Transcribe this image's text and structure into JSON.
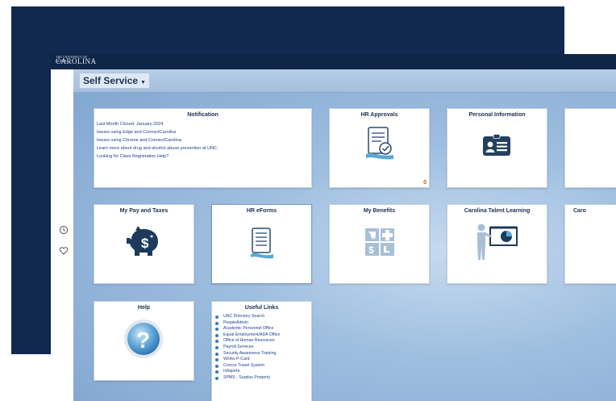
{
  "header": {
    "logo_small": "THE UNIVERSITY OF NORTH",
    "logo_text": "CAROLINA"
  },
  "page": {
    "title": "Self Service"
  },
  "sidebar": {
    "icons": [
      "clock-icon",
      "heart-icon"
    ]
  },
  "tiles": {
    "notification": {
      "title": "Notification",
      "items": [
        "Last Month Closed: January 2024",
        "Issues using Edge and ConnectCarolina",
        "Issues using Chrome and ConnectCarolina",
        "Learn more about drug and alcohol abuse prevention at UNC.",
        "Looking for Class Registration Help?"
      ]
    },
    "hr_approvals": {
      "title": "HR Approvals",
      "count": "0"
    },
    "personal_information": {
      "title": "Personal Information"
    },
    "my_pay": {
      "title": "My Pay and Taxes"
    },
    "hr_eforms": {
      "title": "HR eForms"
    },
    "my_benefits": {
      "title": "My Benefits"
    },
    "talent_learning": {
      "title": "Carolina Talent Learning"
    },
    "partial_car": {
      "title": "Caro"
    },
    "help": {
      "title": "Help"
    },
    "useful_links": {
      "title": "Useful Links",
      "items": [
        "UNC Directory Search",
        "PeopleAdmin",
        "Academic Personnel Office",
        "Equal Employment/ADA Office",
        "Office of Human Resources",
        "Payroll Services",
        "Security Awareness Training",
        "Works P-Card",
        "Concur Travel System",
        "Infoporte",
        "SPMS - Surplus Property"
      ]
    }
  },
  "colors": {
    "navy": "#12294f",
    "topbar": "#0f2647",
    "link": "#1c3f8f",
    "badge": "#c55c00"
  }
}
